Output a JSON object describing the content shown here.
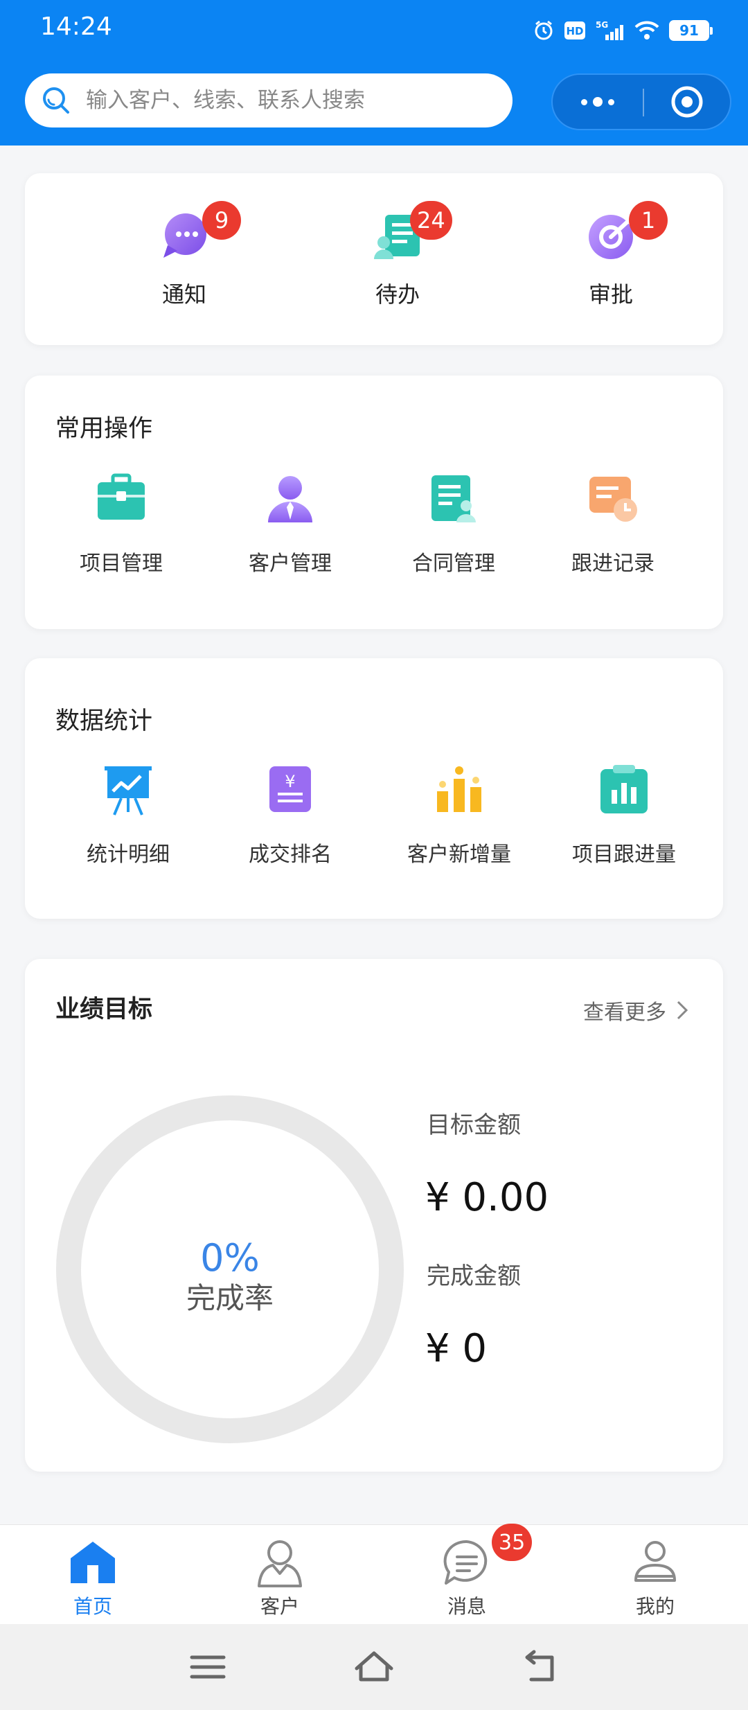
{
  "status_bar": {
    "time": "14:24",
    "icons": [
      "alarm-icon",
      "hd-icon",
      "5g-signal-icon",
      "wifi-icon",
      "battery-icon"
    ],
    "battery": "91"
  },
  "search": {
    "placeholder": "输入客户、线索、联系人搜索"
  },
  "quick_access": [
    {
      "label": "通知",
      "badge": "9",
      "icon": "chat-bubble-icon"
    },
    {
      "label": "待办",
      "badge": "24",
      "icon": "todo-list-icon"
    },
    {
      "label": "审批",
      "badge": "1",
      "icon": "approval-icon"
    }
  ],
  "common_ops": {
    "title": "常用操作",
    "items": [
      {
        "label": "项目管理",
        "icon": "briefcase-icon"
      },
      {
        "label": "客户管理",
        "icon": "customer-icon"
      },
      {
        "label": "合同管理",
        "icon": "contract-icon"
      },
      {
        "label": "跟进记录",
        "icon": "follow-up-icon"
      }
    ]
  },
  "stats": {
    "title": "数据统计",
    "items": [
      {
        "label": "统计明细",
        "icon": "presentation-chart-icon"
      },
      {
        "label": "成交排名",
        "icon": "yen-document-icon"
      },
      {
        "label": "客户新增量",
        "icon": "bar-chart-icon"
      },
      {
        "label": "项目跟进量",
        "icon": "clipboard-chart-icon"
      }
    ]
  },
  "performance": {
    "title": "业绩目标",
    "see_more": "查看更多",
    "completion_percent": "0%",
    "completion_label": "完成率",
    "completion_value": 0,
    "target_label": "目标金额",
    "target_value": "¥ 0.00",
    "done_label": "完成金额",
    "done_value": "¥ 0"
  },
  "tabbar": {
    "items": [
      {
        "label": "首页",
        "icon": "home-icon",
        "active": true
      },
      {
        "label": "客户",
        "icon": "person-icon",
        "active": false
      },
      {
        "label": "消息",
        "icon": "message-icon",
        "active": false,
        "badge": "35"
      },
      {
        "label": "我的",
        "icon": "user-icon",
        "active": false
      }
    ]
  },
  "colors": {
    "header": "#0b84f3",
    "badge": "#ea3a2f",
    "accent": "#3a85e6",
    "tab_active": "#1a7ff0"
  }
}
